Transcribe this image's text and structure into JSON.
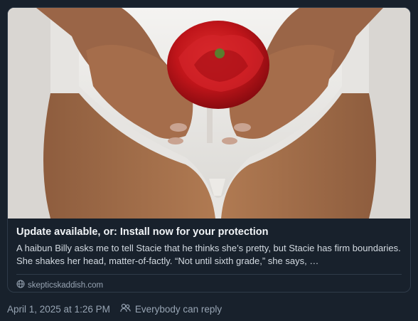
{
  "link_card": {
    "title": "Update available, or: Install now for your protection",
    "description": "A haibun Billy asks me to tell Stacie that he thinks she’s pretty, but Stacie has firm boundaries. She shakes her head, matter-of-factly. “Not until sixth grade,” she says, …",
    "domain": "skepticskaddish.com",
    "domain_icon": "globe-icon"
  },
  "post_meta": {
    "timestamp": "April 1, 2025 at 1:26 PM",
    "reply_setting": "Everybody can reply",
    "reply_icon": "people-icon"
  },
  "colors": {
    "background": "#18212c",
    "border": "#2f3b49",
    "muted_text": "#97a4b3",
    "rose": "#c8161c"
  }
}
